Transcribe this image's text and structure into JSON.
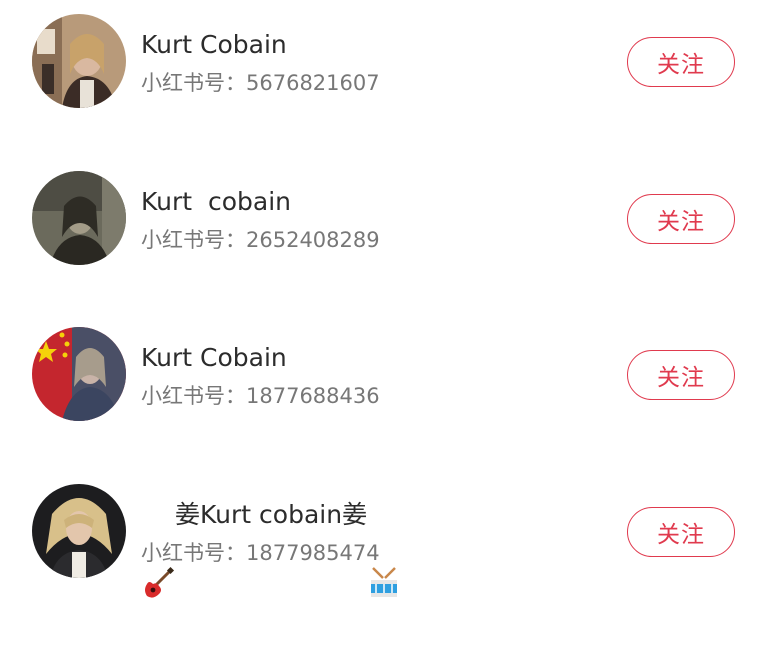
{
  "users": [
    {
      "name": "Kurt Cobain",
      "id_label": "小红书号：",
      "id_value": "5676821607",
      "follow_label": "关注"
    },
    {
      "name": "Kurt  cobain",
      "id_label": "小红书号：",
      "id_value": "2652408289",
      "follow_label": "关注"
    },
    {
      "name": "Kurt Cobain",
      "id_label": "小红书号：",
      "id_value": "1877688436",
      "follow_label": "关注"
    },
    {
      "name_prefix": "姜",
      "name": "Kurt cobain",
      "name_suffix": "姜",
      "id_label": "小红书号：",
      "id_value": "1877985474",
      "follow_label": "关注",
      "emoji_left": "guitar-emoji",
      "emoji_right": "drum-emoji"
    }
  ],
  "colors": {
    "accent": "#e03a4e",
    "name_text": "#2c2c2c",
    "id_text": "#777777"
  }
}
